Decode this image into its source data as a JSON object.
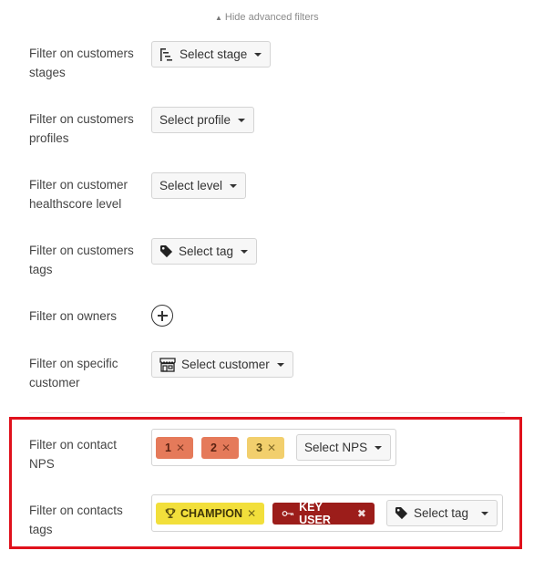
{
  "header": {
    "hide_filters_label": "Hide advanced filters"
  },
  "filters": {
    "stages": {
      "label": "Filter on customers stages",
      "button": "Select stage",
      "icon": "stages-icon"
    },
    "profiles": {
      "label": "Filter on customers profiles",
      "button": "Select profile"
    },
    "healthscore": {
      "label": "Filter on customer healthscore level",
      "button": "Select level"
    },
    "tags": {
      "label": "Filter on customers tags",
      "button": "Select tag",
      "icon": "tag-icon"
    },
    "owners": {
      "label": "Filter on owners",
      "icon": "plus-circle-icon"
    },
    "customer": {
      "label": "Filter on specific customer",
      "button": "Select customer",
      "icon": "store-icon"
    }
  },
  "contact_filters": {
    "nps": {
      "label": "Filter on contact NPS",
      "chips": [
        {
          "label": "1",
          "color": "#e57a5a"
        },
        {
          "label": "2",
          "color": "#e57a5a"
        },
        {
          "label": "3",
          "color": "#f2cf6d"
        }
      ],
      "button": "Select NPS"
    },
    "tags": {
      "label": "Filter on contacts tags",
      "chips": [
        {
          "label": "CHAMPION",
          "color": "#f2df3b",
          "icon": "trophy-icon"
        },
        {
          "label": "KEY USER",
          "color": "#9c1d1a",
          "icon": "key-icon"
        }
      ],
      "button": "Select tag",
      "icon": "tag-icon"
    }
  },
  "colors": {
    "highlight": "#e0111c"
  }
}
